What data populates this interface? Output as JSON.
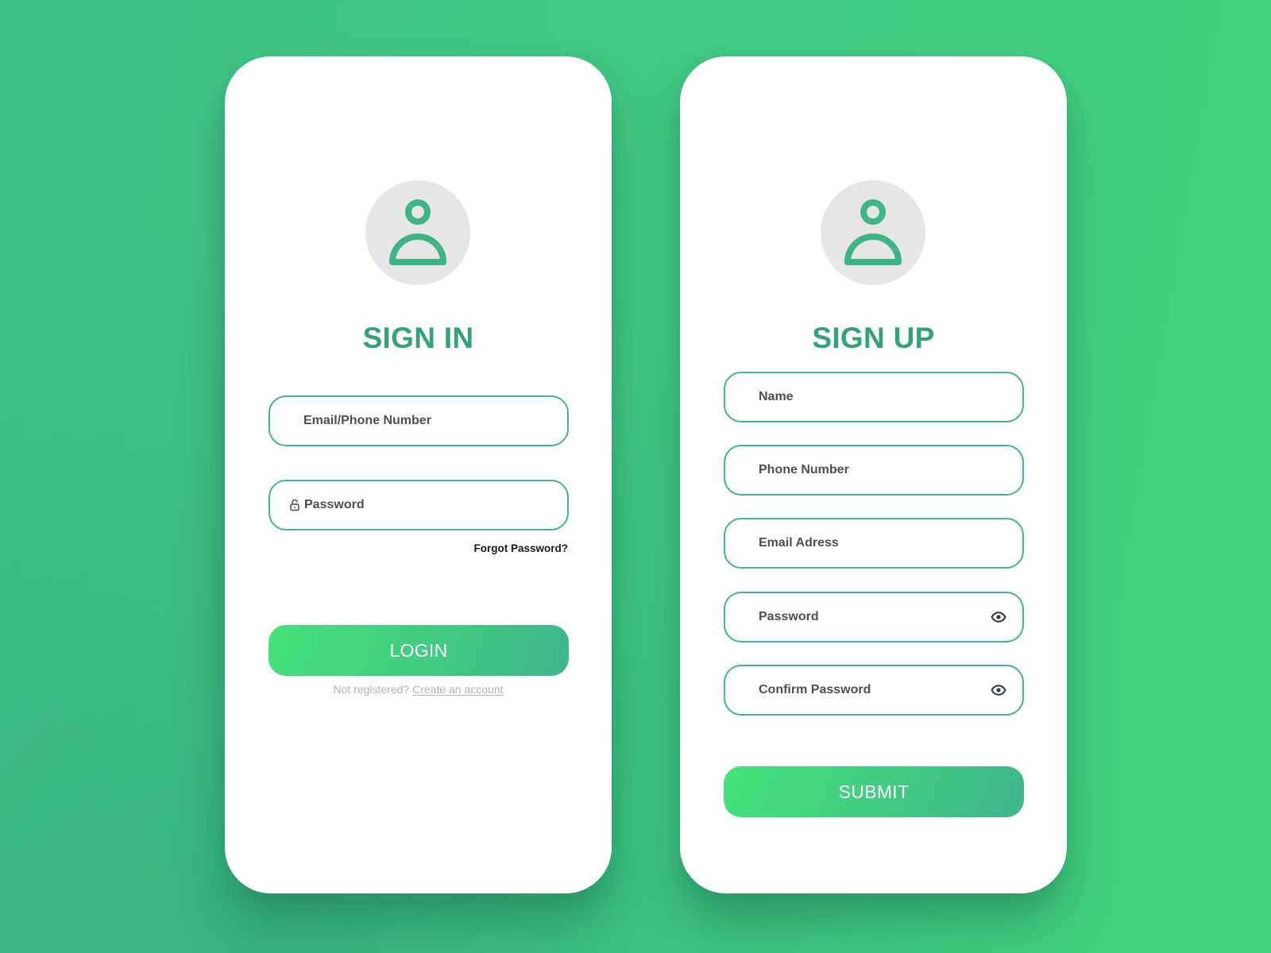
{
  "colors": {
    "accent": "#35a276",
    "field_border": "#43b587",
    "button_gradient_start": "#45e27a",
    "button_gradient_end": "#3fb48b",
    "avatar_bg": "#e6e6e6",
    "background": "#42c884"
  },
  "sign_in": {
    "avatar_icon": "user-icon",
    "title": "SIGN IN",
    "fields": [
      {
        "name": "email-phone",
        "placeholder": "Email/Phone Number",
        "value": "",
        "icon": null
      },
      {
        "name": "password",
        "placeholder": "Password",
        "value": "",
        "icon": "lock-icon"
      }
    ],
    "forgot_password": "Forgot Password?",
    "login_button": "LOGIN",
    "register_prompt": "Not registered?",
    "register_link": "Create an account"
  },
  "sign_up": {
    "avatar_icon": "user-icon",
    "title": "SIGN UP",
    "fields": [
      {
        "name": "name",
        "placeholder": "Name",
        "value": "",
        "icon": null
      },
      {
        "name": "phone-number",
        "placeholder": "Phone Number",
        "value": "",
        "icon": null
      },
      {
        "name": "email-address",
        "placeholder": "Email Adress",
        "value": "",
        "icon": null
      },
      {
        "name": "password",
        "placeholder": "Password",
        "value": "",
        "icon": "eye-icon"
      },
      {
        "name": "confirm-password",
        "placeholder": "Confirm Password",
        "value": "",
        "icon": "eye-icon"
      }
    ],
    "submit_button": "SUBMIT"
  }
}
